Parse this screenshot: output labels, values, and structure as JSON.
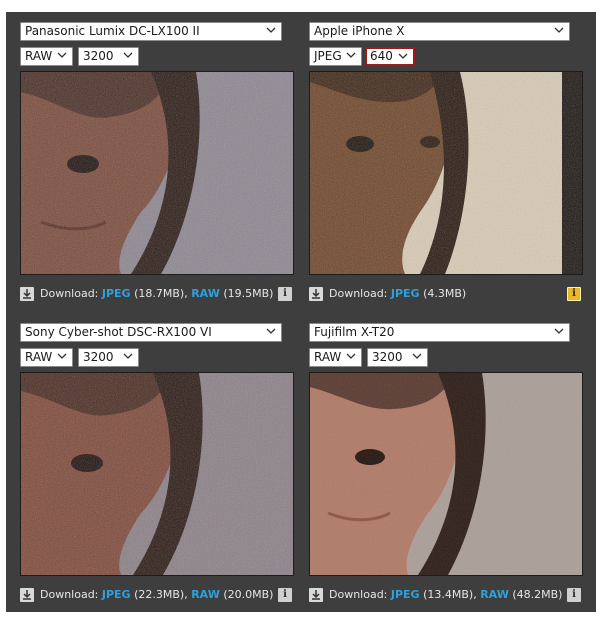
{
  "panels": [
    {
      "camera": "Panasonic Lumix DC-LX100 II",
      "format": "RAW",
      "iso": "3200",
      "iso_active": false,
      "download": {
        "label": "Download:",
        "jpeg_label": "JPEG",
        "jpeg_size": "(18.7MB),",
        "raw_label": "RAW",
        "raw_size": "(19.5MB)"
      },
      "info_icon": "info-icon"
    },
    {
      "camera": "Apple iPhone X",
      "format": "JPEG",
      "iso": "640",
      "iso_active": true,
      "download": {
        "label": "Download:",
        "jpeg_label": "JPEG",
        "jpeg_size": "(4.3MB)"
      },
      "info_icon": "info-warning-icon"
    },
    {
      "camera": "Sony Cyber-shot DSC-RX100 VI",
      "format": "RAW",
      "iso": "3200",
      "iso_active": false,
      "download": {
        "label": "Download:",
        "jpeg_label": "JPEG",
        "jpeg_size": "(22.3MB),",
        "raw_label": "RAW",
        "raw_size": "(20.0MB)"
      },
      "info_icon": "info-icon"
    },
    {
      "camera": "Fujifilm X-T20",
      "format": "RAW",
      "iso": "3200",
      "iso_active": false,
      "download": {
        "label": "Download:",
        "jpeg_label": "JPEG",
        "jpeg_size": "(13.4MB),",
        "raw_label": "RAW",
        "raw_size": "(48.2MB)"
      },
      "info_icon": "info-icon"
    }
  ],
  "colors": {
    "background": "#3e3e3e",
    "link": "#2fa0de",
    "active_border": "#a01818",
    "warning": "#e8b82a"
  }
}
